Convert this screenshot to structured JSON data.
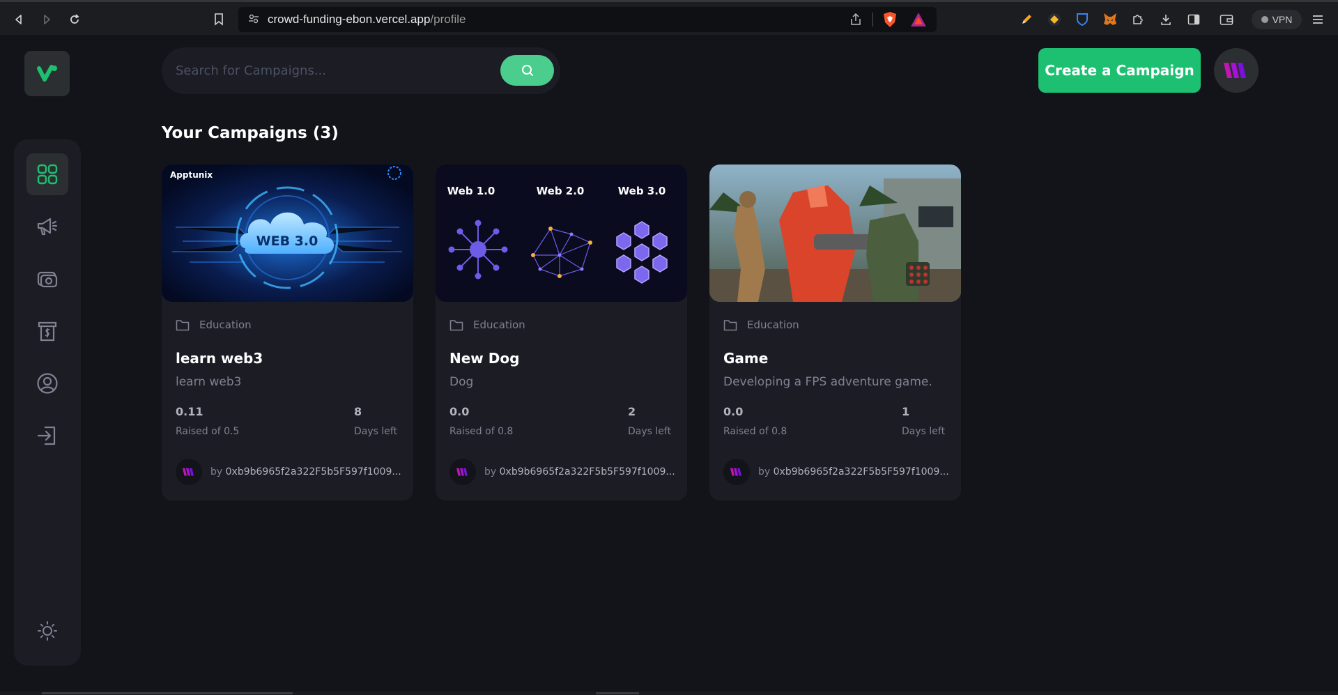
{
  "browser": {
    "url_host": "crowd-funding-ebon.vercel.app",
    "url_path": "/profile",
    "vpn_label": "VPN"
  },
  "search": {
    "placeholder": "Search for Campaigns..."
  },
  "header": {
    "create_label": "Create a Campaign"
  },
  "section": {
    "title": "Your Campaigns (3)"
  },
  "colors": {
    "accent": "#1dc071",
    "search_button": "#4acd8d",
    "card_bg": "#1c1c24",
    "page_bg": "#13131a"
  },
  "campaigns": [
    {
      "category": "Education",
      "title": "learn web3",
      "description": "learn web3",
      "raised": "0.11",
      "raised_label": "Raised of 0.5",
      "days": "8",
      "days_label": "Days left",
      "owner_prefix": "by ",
      "owner": "0xb9b6965f2a322F5b5F597f1009...",
      "image": {
        "brand": "Apptunix",
        "badge": "WEB 3.0"
      }
    },
    {
      "category": "Education",
      "title": "New Dog",
      "description": "Dog",
      "raised": "0.0",
      "raised_label": "Raised of 0.8",
      "days": "2",
      "days_label": "Days left",
      "owner_prefix": "by ",
      "owner": "0xb9b6965f2a322F5b5F597f1009...",
      "image": {
        "labels": [
          "Web 1.0",
          "Web 2.0",
          "Web 3.0"
        ]
      }
    },
    {
      "category": "Education",
      "title": "Game",
      "description": "Developing a FPS adventure game.",
      "raised": "0.0",
      "raised_label": "Raised of 0.8",
      "days": "1",
      "days_label": "Days left",
      "owner_prefix": "by ",
      "owner": "0xb9b6965f2a322F5b5F597f1009...",
      "image": {}
    }
  ]
}
